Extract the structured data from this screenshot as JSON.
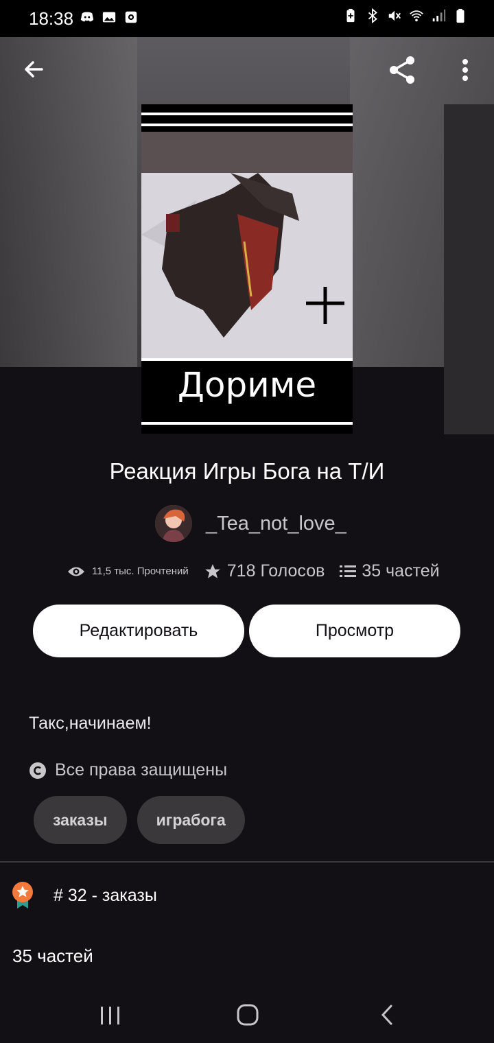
{
  "status_bar": {
    "time": "18:38",
    "left_icons": [
      "discord-icon",
      "gallery-icon",
      "screen-record-icon"
    ],
    "right_icons": [
      "battery-saver-icon",
      "bluetooth-icon",
      "mute-icon",
      "wifi-icon",
      "signal-icon",
      "battery-icon"
    ]
  },
  "header": {
    "back_icon": "arrow-left-icon",
    "share_icon": "share-icon",
    "more_icon": "more-vertical-icon"
  },
  "cover": {
    "title": "Дориме"
  },
  "story": {
    "title": "Реакция Игры Бога на Т/И",
    "author": "_Tea_not_love_",
    "reads": "11,5 тыс. Прочтений",
    "votes": "718 Голосов",
    "parts": "35 частей"
  },
  "actions": {
    "edit_label": "Редактировать",
    "view_label": "Просмотр"
  },
  "description": "Такс,начинаем!",
  "copyright": "Все права защищены",
  "tags": [
    "заказы",
    "играбога"
  ],
  "ranking": {
    "text": "# 32 - заказы"
  },
  "parts_count": "35 частей",
  "colors": {
    "background": "#121015",
    "button_bg": "#ffffff",
    "tag_bg": "#3a383b",
    "rank_badge": "#f47a3c"
  }
}
